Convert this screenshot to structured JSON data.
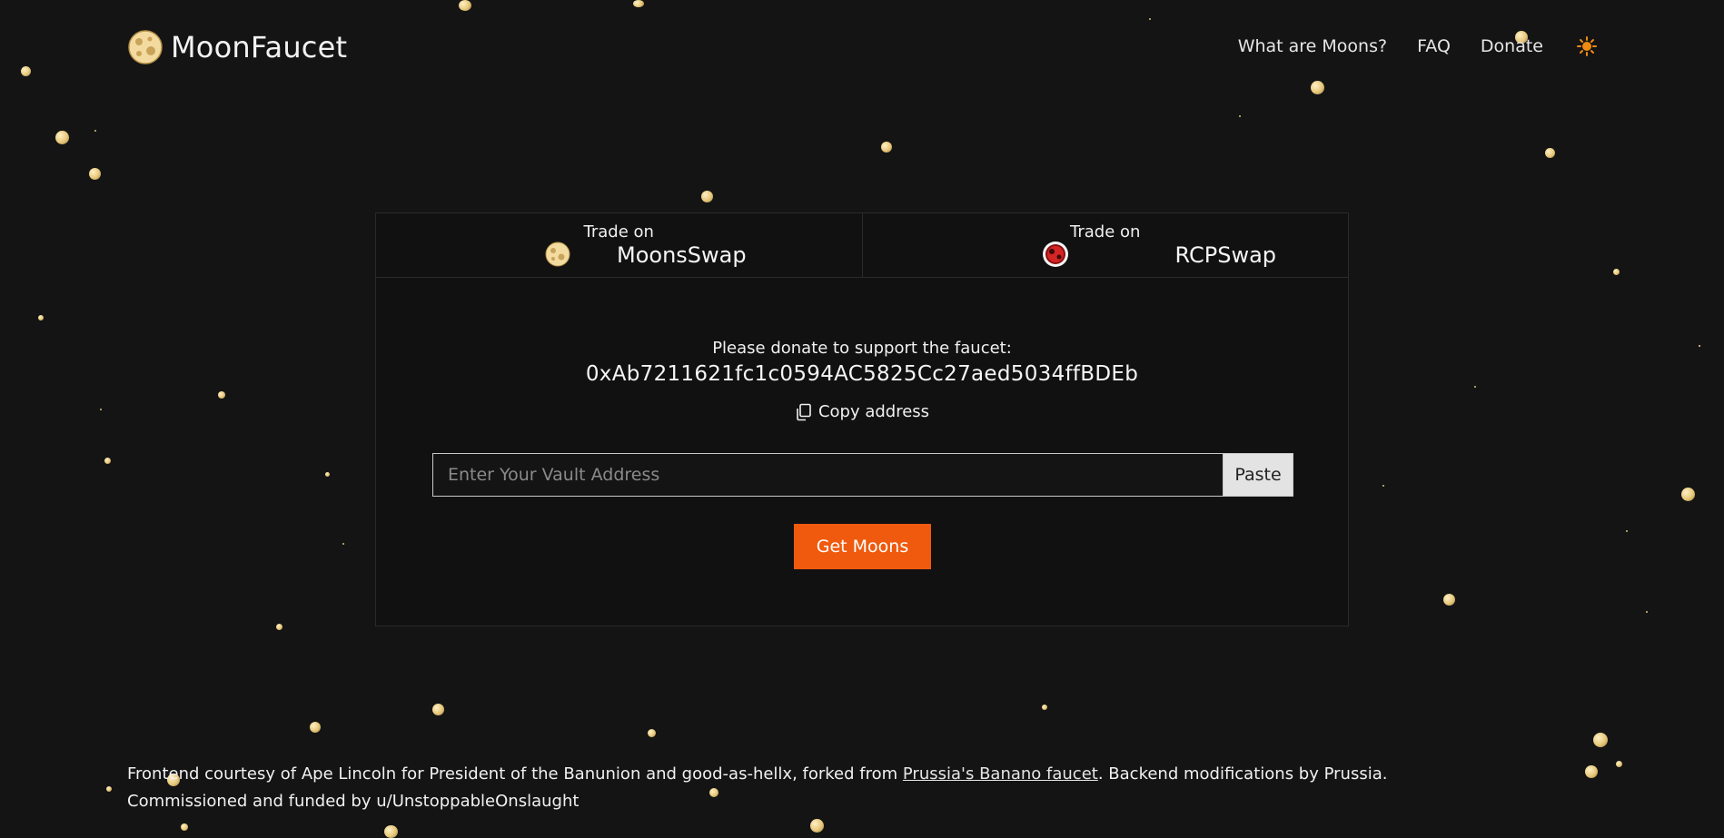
{
  "header": {
    "brand": "MoonFaucet",
    "nav": {
      "what_are_moons": "What are Moons?",
      "faq": "FAQ",
      "donate": "Donate"
    }
  },
  "trade": {
    "moonsswap": {
      "prefix": "Trade on",
      "name": "MoonsSwap"
    },
    "rcpswap": {
      "prefix": "Trade on",
      "name": "RCPSwap"
    }
  },
  "donation": {
    "text": "Please donate to support the faucet:",
    "address": "0xAb7211621fc1c0594AC5825Cc27aed5034ffBDEb",
    "copy_label": "Copy address"
  },
  "form": {
    "vault_placeholder": "Enter Your Vault Address",
    "vault_value": "",
    "paste_label": "Paste",
    "submit_label": "Get Moons"
  },
  "footer": {
    "line1_before": "Frontend courtesy of Ape Lincoln for President of the Banunion and good-as-hellx, forked from ",
    "link_text": "Prussia's Banano faucet",
    "line1_after": ". Backend modifications by Prussia.",
    "line2": "Commissioned and funded by u/UnstoppableOnslaught"
  },
  "colors": {
    "background": "#141414",
    "accent_orange": "#f05a0e",
    "moon_gold": "#e6c77a"
  },
  "icons": [
    "moon-logo-icon",
    "sun-theme-icon",
    "moonsswap-icon",
    "rcpswap-icon",
    "copy-icon"
  ]
}
